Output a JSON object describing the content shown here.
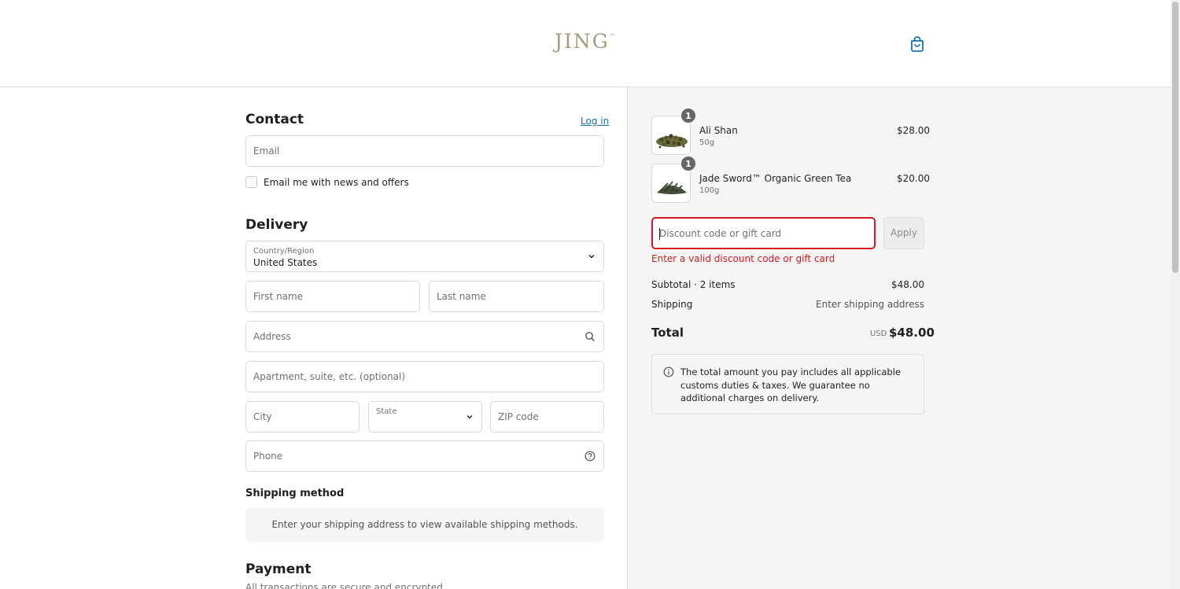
{
  "brand": {
    "logo_text": "JING",
    "logo_tm": "™",
    "color": "#a59a7f"
  },
  "header": {
    "cart_icon": "shopping-bag-icon"
  },
  "contact": {
    "title": "Contact",
    "login_link": "Log in",
    "email_placeholder": "Email",
    "newsletter_label": "Email me with news and offers"
  },
  "delivery": {
    "title": "Delivery",
    "country_label": "Country/Region",
    "country_value": "United States",
    "first_name_placeholder": "First name",
    "last_name_placeholder": "Last name",
    "address_placeholder": "Address",
    "apartment_placeholder": "Apartment, suite, etc. (optional)",
    "city_placeholder": "City",
    "state_label": "State",
    "zip_placeholder": "ZIP code",
    "phone_placeholder": "Phone"
  },
  "shipping_method": {
    "title": "Shipping method",
    "notice": "Enter your shipping address to view available shipping methods."
  },
  "payment": {
    "title": "Payment",
    "subtitle": "All transactions are secure and encrypted."
  },
  "order": {
    "items": [
      {
        "name": "Ali Shan",
        "variant": "50g",
        "price": "$28.00",
        "quantity": "1"
      },
      {
        "name": "Jade Sword™ Organic Green Tea",
        "variant": "100g",
        "price": "$20.00",
        "quantity": "1"
      }
    ],
    "discount_placeholder": "Discount code or gift card",
    "apply_label": "Apply",
    "discount_error": "Enter a valid discount code or gift card",
    "subtotal_label": "Subtotal · 2 items",
    "subtotal_value": "$48.00",
    "shipping_label": "Shipping",
    "shipping_value": "Enter shipping address",
    "total_label": "Total",
    "total_currency": "USD",
    "total_value": "$48.00",
    "duties_notice": "The total amount you pay includes all applicable customs duties & taxes. We guarantee no additional charges on delivery."
  },
  "colors": {
    "link": "#1773b0",
    "error": "#d31a23",
    "panel_bg": "#f5f5f5"
  }
}
